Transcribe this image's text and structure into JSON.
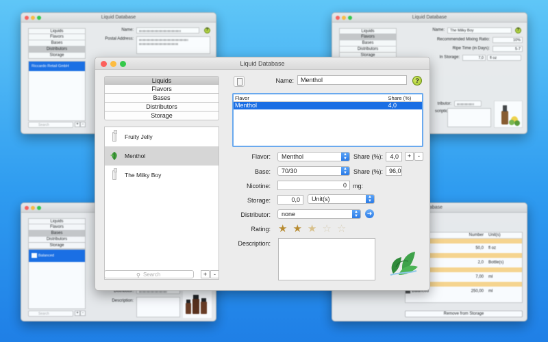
{
  "colors": {
    "desktop_top": "#5fc6f7",
    "desktop_bottom": "#1f7fe6",
    "selection_blue": "#1a6ee4",
    "star_gold": "#b78a2e"
  },
  "main_window": {
    "title": "Liquid Database",
    "sections": [
      "Liquids",
      "Flavors",
      "Bases",
      "Distributors",
      "Storage"
    ],
    "selected_section": "Liquids",
    "liquids": [
      {
        "name": "Fruity Jelly",
        "icon": "bottle-icon"
      },
      {
        "name": "Menthol",
        "icon": "mint-leaf-icon"
      },
      {
        "name": "The Milky Boy",
        "icon": "bottle-icon"
      }
    ],
    "selected_liquid": "Menthol",
    "search_placeholder": "Search",
    "add_label": "+",
    "remove_label": "-",
    "name_label": "Name:",
    "name_value": "Menthol",
    "help_label": "?",
    "flavor_table": {
      "headers": [
        "Flavor",
        "Share (%)"
      ],
      "rows": [
        [
          "Menthol",
          "4,0"
        ]
      ]
    },
    "flavor_label": "Flavor:",
    "flavor_value": "Menthol",
    "share_label": "Share (%):",
    "flavor_share": "4,0",
    "base_label": "Base:",
    "base_value": "70/30",
    "base_share": "96,0",
    "nicotine_label": "Nicotine:",
    "nicotine_value": "0",
    "nicotine_unit": "mg:",
    "storage_label": "Storage:",
    "storage_value": "0,0",
    "storage_unit": "Unit(s)",
    "distributor_label": "Distributor:",
    "distributor_value": "none",
    "rating_label": "Rating:",
    "rating_value": 2.5,
    "rating_max": 5,
    "description_label": "Description:",
    "description_value": ""
  },
  "bg_distributors": {
    "title": "Liquid Database",
    "sections": [
      "Liquids",
      "Flavors",
      "Bases",
      "Distributors",
      "Storage"
    ],
    "selected_section": "Distributors",
    "selected_item": "Riccardo Retail GmbH",
    "name_label": "Name:",
    "address_label": "Postal Address:",
    "search_placeholder": "Search"
  },
  "bg_flavors": {
    "title": "Liquid Database",
    "sections": [
      "Liquids",
      "Flavors",
      "Bases",
      "Distributors",
      "Storage"
    ],
    "selected_section": "Flavors",
    "name_label": "Name:",
    "name_value": "The Milky Boy",
    "mixing_label": "Recommended Mixing Ratio:",
    "mixing_value": "10%",
    "ripe_label": "Ripe Time (in Days):",
    "ripe_value": "5-7",
    "storage_label": "In Storage:",
    "storage_value": "7,0",
    "storage_unit": "fl oz",
    "distributor_label": "tributor:",
    "description_label": "scription:"
  },
  "bg_bases": {
    "sections": [
      "Liquids",
      "Flavors",
      "Bases",
      "Distributors",
      "Storage"
    ],
    "selected_section": "Bases",
    "selected_item": "Balanced",
    "distributor_label": "Distributor:",
    "description_label": "Description:",
    "search_placeholder": "Search"
  },
  "bg_storage": {
    "title": "abase",
    "headers": [
      "Number",
      "Unit(s)"
    ],
    "rows": [
      {
        "label": "",
        "number": "50,0",
        "unit": "fl oz"
      },
      {
        "label": "",
        "number": "2,0",
        "unit": "Bottle(s)"
      },
      {
        "label": "",
        "number": "7,00",
        "unit": "ml"
      },
      {
        "label": "Balanced",
        "number": "250,00",
        "unit": "ml"
      }
    ],
    "remove_button": "Remove from Storage"
  }
}
